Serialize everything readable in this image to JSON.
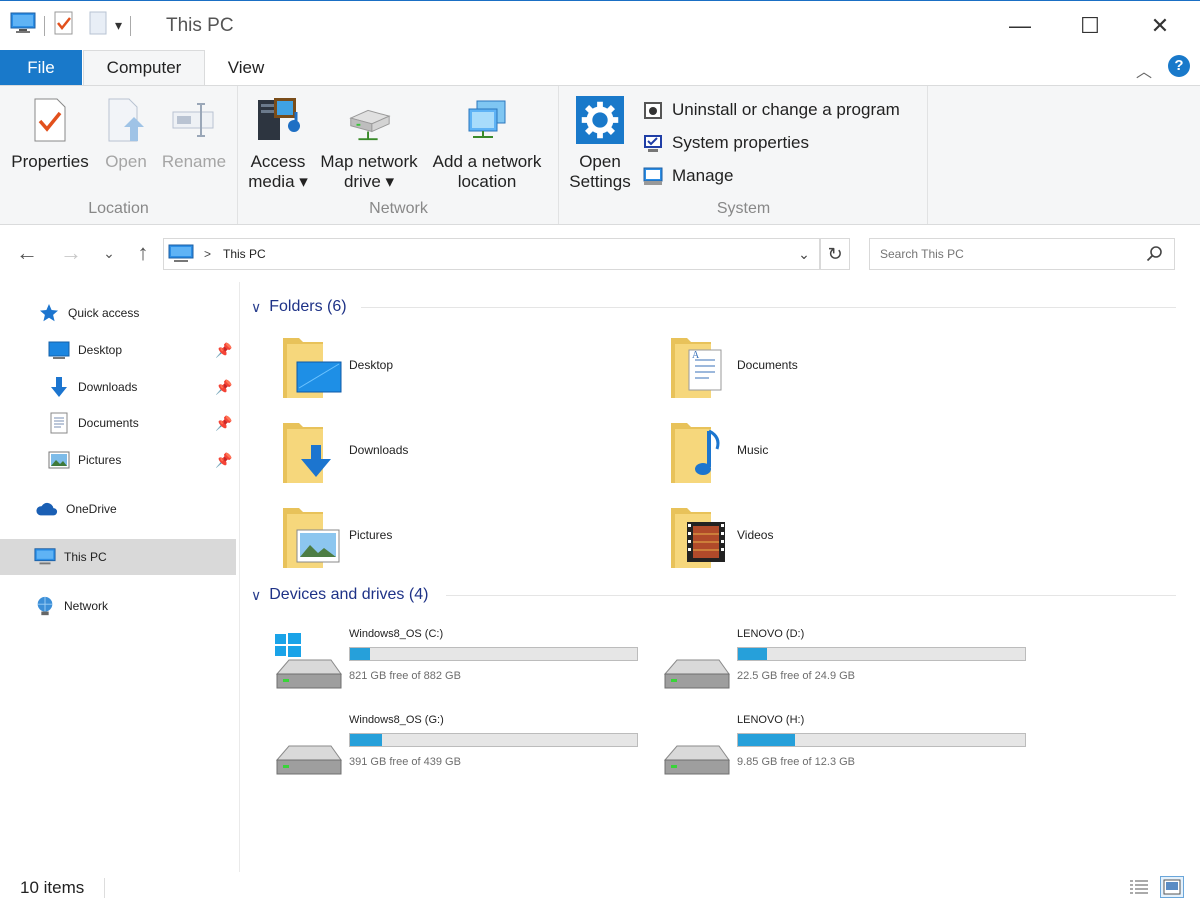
{
  "window": {
    "title": "This PC",
    "minimize": "—",
    "maximize": "☐",
    "close": "✕"
  },
  "ribbon": {
    "tabs": {
      "file": "File",
      "computer": "Computer",
      "view": "View"
    },
    "groups": {
      "location": {
        "label": "Location",
        "properties": "Properties",
        "open": "Open",
        "rename": "Rename"
      },
      "network": {
        "label": "Network",
        "access_media_1": "Access",
        "access_media_2": "media ▾",
        "map_drive_1": "Map network",
        "map_drive_2": "drive ▾",
        "add_location_1": "Add a network",
        "add_location_2": "location"
      },
      "system": {
        "label": "System",
        "open_settings_1": "Open",
        "open_settings_2": "Settings",
        "uninstall": "Uninstall or change a program",
        "system_properties": "System properties",
        "manage": "Manage"
      }
    }
  },
  "address": {
    "crumb": "This PC",
    "search_placeholder": "Search This PC"
  },
  "nav": {
    "quick_access": "Quick access",
    "desktop": "Desktop",
    "downloads": "Downloads",
    "documents": "Documents",
    "pictures": "Pictures",
    "onedrive": "OneDrive",
    "this_pc": "This PC",
    "network": "Network"
  },
  "folders": {
    "header": "Folders (6)",
    "items": [
      "Desktop",
      "Documents",
      "Downloads",
      "Music",
      "Pictures",
      "Videos"
    ]
  },
  "drives": {
    "header": "Devices and drives (4)",
    "items": [
      {
        "name": "Windows8_OS (C:)",
        "free": "821 GB free of 882 GB",
        "used_fraction": 0.07
      },
      {
        "name": "LENOVO (D:)",
        "free": "22.5 GB free of 24.9 GB",
        "used_fraction": 0.1
      },
      {
        "name": "Windows8_OS (G:)",
        "free": "391 GB free of 439 GB",
        "used_fraction": 0.11
      },
      {
        "name": "LENOVO (H:)",
        "free": "9.85 GB free of 12.3 GB",
        "used_fraction": 0.2
      }
    ]
  },
  "status": {
    "count": "10 items"
  },
  "colors": {
    "accent": "#1979ca",
    "drive_bar": "#26a0da",
    "section_header": "#1e3287"
  }
}
